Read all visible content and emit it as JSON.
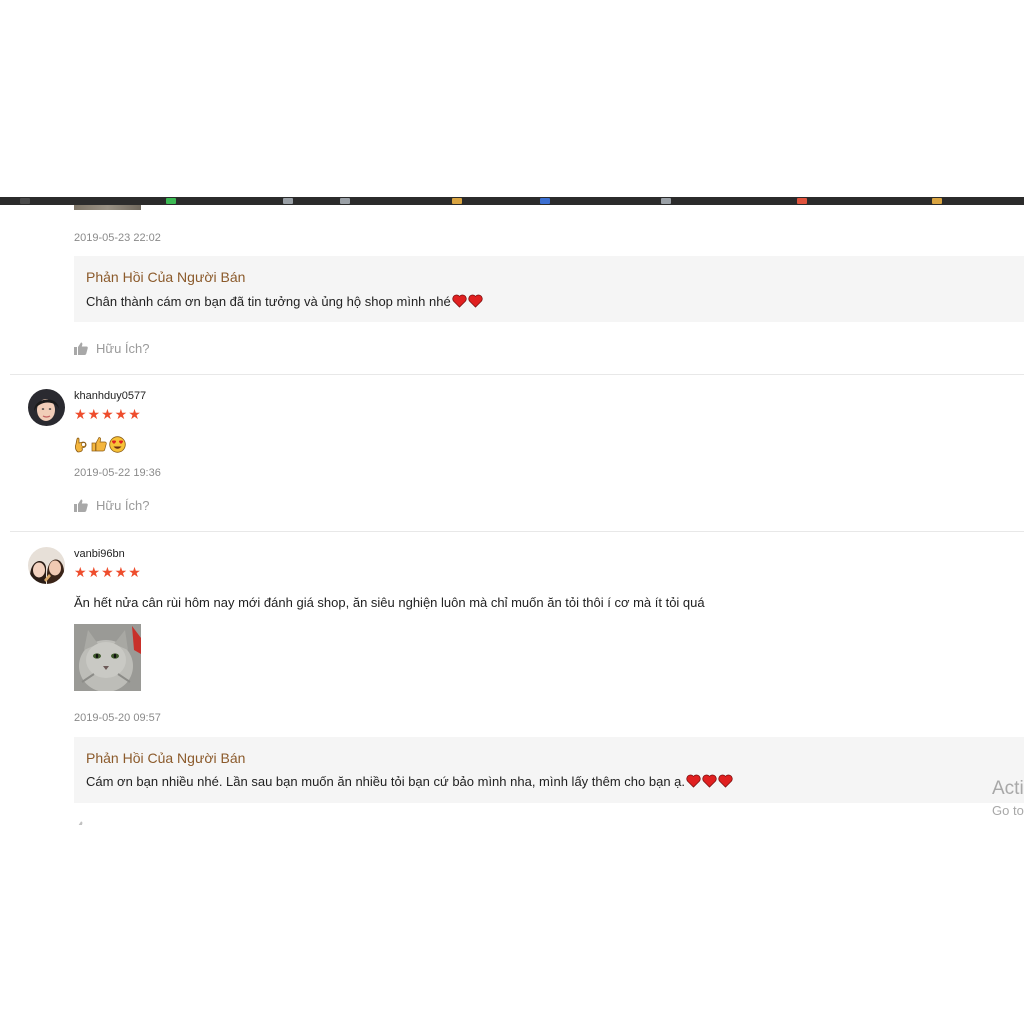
{
  "taskbar": {
    "item_colors": [
      "#4a4a4a",
      "#3cba54",
      "#9aa0a6",
      "#9aa0a6",
      "#d9a441",
      "#3b6fd1",
      "#9aa0a6",
      "#e0533d",
      "#d9a441"
    ]
  },
  "reviews": [
    {
      "date": "2019-05-23 22:02",
      "seller_reply": {
        "title": "Phản Hồi Của Người Bán",
        "text": "Chân thành cám ơn bạn đã tin tưởng và ủng hộ shop mình nhé"
      },
      "helpful_label": "Hữu Ích?"
    },
    {
      "username": "khanhduy0577",
      "rating": 5,
      "stars": "★★★★★",
      "comment_emojis": [
        "ok-hand",
        "thumbs-up",
        "heart-eyes"
      ],
      "date": "2019-05-22 19:36",
      "helpful_label": "Hữu Ích?"
    },
    {
      "username": "vanbi96bn",
      "rating": 5,
      "stars": "★★★★★",
      "comment": "Ăn hết nửa cân rùi hôm nay mới đánh giá shop, ăn siêu nghiện luôn mà chỉ muốn ăn tỏi thôi í cơ mà ít tỏi quá",
      "photo_icon": "cat-photo",
      "date": "2019-05-20 09:57",
      "seller_reply": {
        "title": "Phản Hồi Của Người Bán",
        "text": "Cám ơn bạn nhiều nhé. Lần sau bạn muốn ăn nhiều tỏi bạn cứ bảo mình nha, mình lấy thêm cho bạn ạ."
      }
    }
  ],
  "watermark": {
    "line1": "Acti",
    "line2": "Go to"
  },
  "colors": {
    "star": "#ee4d2d",
    "heart": "#e02020",
    "reply_title": "#8b5a2b"
  }
}
